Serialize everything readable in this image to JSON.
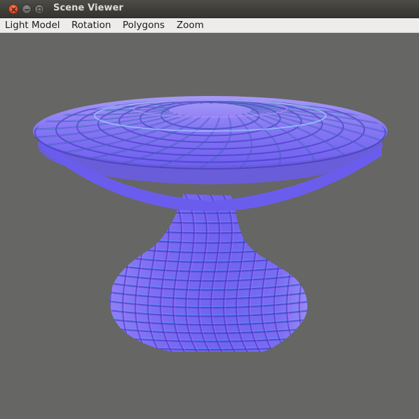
{
  "window": {
    "title": "Scene Viewer",
    "controls": [
      "close-icon",
      "minimize-icon",
      "maximize-icon"
    ]
  },
  "menubar": {
    "items": [
      {
        "label": "Light Model"
      },
      {
        "label": "Rotation"
      },
      {
        "label": "Polygons"
      },
      {
        "label": "Zoom"
      }
    ]
  },
  "scene": {
    "background_color": "#666664",
    "object": "normal-mapped-vase-mesh",
    "mesh_color": "#7a6cf2",
    "seam_colors": [
      "#3fb8ff",
      "#d46cff",
      "#62f0c8"
    ]
  }
}
